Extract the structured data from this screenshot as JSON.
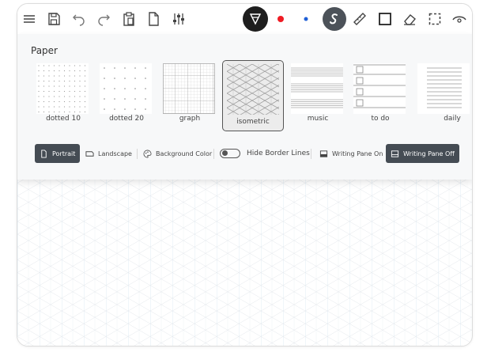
{
  "toolbar": {
    "icons": [
      "menu-icon",
      "save-icon",
      "undo-icon",
      "redo-icon",
      "clipboard-icon",
      "new-page-icon",
      "sliders-icon",
      "pen-tip-icon",
      "red-dot",
      "blue-dot",
      "pen-s-icon",
      "ruler-icon",
      "rectangle-icon",
      "eraser-icon",
      "selection-icon",
      "eye-icon"
    ],
    "active_tool_color": "#1e1e1e",
    "pen_color": "#ef1c24",
    "dot_color": "#1f5fd6"
  },
  "panel": {
    "title": "Paper",
    "papers": [
      {
        "label": "dotted 10"
      },
      {
        "label": "dotted 20"
      },
      {
        "label": "graph"
      },
      {
        "label": "isometric"
      },
      {
        "label": "music"
      },
      {
        "label": "to do"
      },
      {
        "label": "daily"
      }
    ],
    "selected_paper": "isometric",
    "options": {
      "portrait": "Portrait",
      "landscape": "Landscape",
      "background_color": "Background Color",
      "hide_border_lines": "Hide Border Lines",
      "writing_pane_on": "Writing Pane On",
      "writing_pane_off": "Writing Pane Off"
    }
  },
  "colors": {
    "accent_dark": "#454c54",
    "grid_light": "#e4e8ec",
    "grid_blue": "#cfe2f3"
  }
}
